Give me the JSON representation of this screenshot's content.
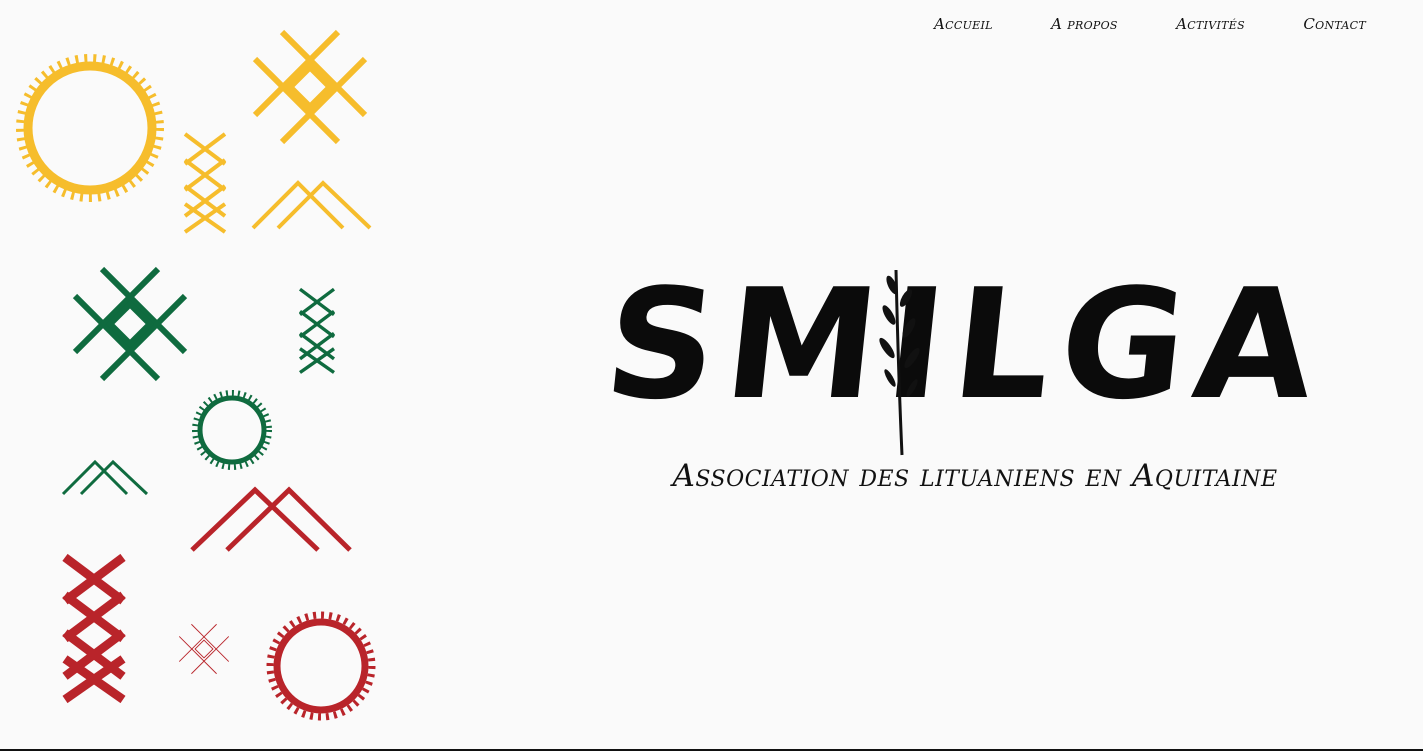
{
  "nav": {
    "items": [
      {
        "label": "Accueil"
      },
      {
        "label": "A propos"
      },
      {
        "label": "Activités"
      },
      {
        "label": "Contact"
      }
    ]
  },
  "logo": {
    "word": "SMILGA",
    "subtitle": "Association des lituaniens en Aquitaine"
  },
  "colors": {
    "yellow": "#f6bd2c",
    "green": "#0f6b3f",
    "red": "#b9242a",
    "text": "#111111",
    "background": "#fafafa"
  },
  "decor": {
    "ornament_icons": [
      "sun-icon",
      "diamond-cross-icon",
      "x-chain-icon",
      "mountain-icon"
    ],
    "sprig_icon": "grass-sprig-icon"
  }
}
